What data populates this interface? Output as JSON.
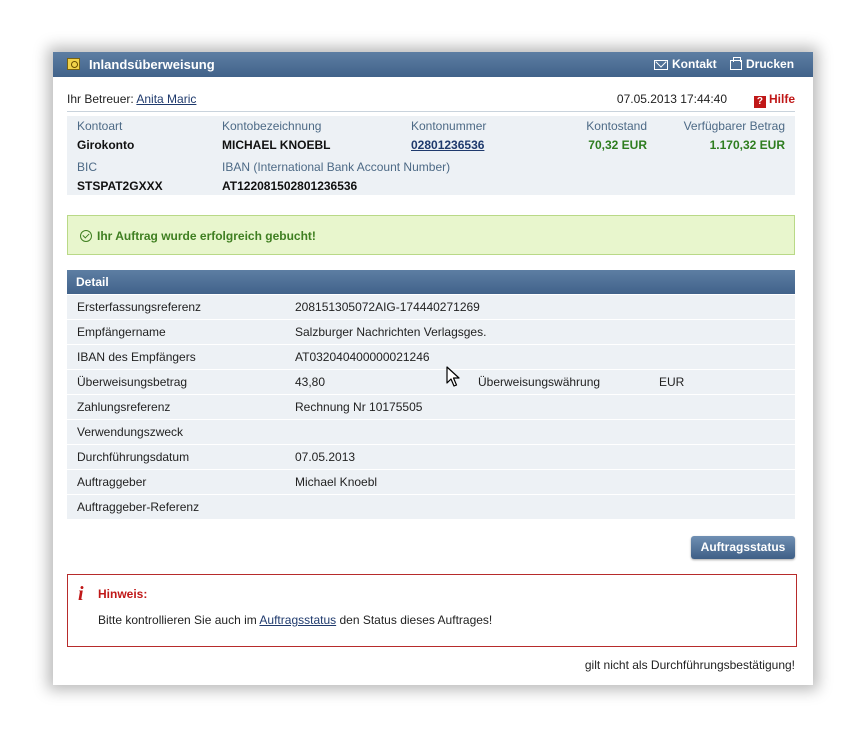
{
  "window": {
    "title": "Inlandsüberweisung",
    "links": {
      "kontakt": "Kontakt",
      "drucken": "Drucken"
    }
  },
  "header": {
    "betreuer_label": "Ihr Betreuer:",
    "betreuer_name": "Anita Maric",
    "datetime": "07.05.2013 17:44:40",
    "hilfe": "Hilfe"
  },
  "account": {
    "labels": {
      "kontoart": "Kontoart",
      "kontobezeichnung": "Kontobezeichnung",
      "kontonummer": "Kontonummer",
      "kontostand": "Kontostand",
      "verfuegbar": "Verfügbarer Betrag",
      "bic": "BIC",
      "iban": "IBAN (International Bank Account Number)"
    },
    "values": {
      "kontoart": "Girokonto",
      "kontobezeichnung": "MICHAEL KNOEBL",
      "kontonummer": "02801236536",
      "kontostand": "70,32 EUR",
      "verfuegbar": "1.170,32 EUR",
      "bic": "STSPAT2GXXX",
      "iban": "AT122081502801236536"
    }
  },
  "success_message": "Ihr Auftrag wurde erfolgreich gebucht!",
  "detail": {
    "title": "Detail",
    "rows": [
      {
        "label": "Ersterfassungsreferenz",
        "value": "208151305072AIG-174440271269"
      },
      {
        "label": "Empfängername",
        "value": "Salzburger Nachrichten Verlagsges."
      },
      {
        "label": "IBAN des Empfängers",
        "value": "AT032040400000021246"
      },
      {
        "label": "Überweisungsbetrag",
        "value": "43,80",
        "label2": "Überweisungswährung",
        "value2": "EUR"
      },
      {
        "label": "Zahlungsreferenz",
        "value": "Rechnung Nr 10175505"
      },
      {
        "label": "Verwendungszweck",
        "value": ""
      },
      {
        "label": "Durchführungsdatum",
        "value": "07.05.2013"
      },
      {
        "label": "Auftraggeber",
        "value": "Michael Knoebl"
      },
      {
        "label": "Auftraggeber-Referenz",
        "value": ""
      }
    ]
  },
  "buttons": {
    "auftragsstatus": "Auftragsstatus"
  },
  "hinweis": {
    "title": "Hinweis:",
    "text_before": "Bitte kontrollieren Sie auch im",
    "link": "Auftragsstatus",
    "text_after": "den Status dieses Auftrages!"
  },
  "footer_note": "gilt nicht als Durchführungsbestätigung!",
  "colors": {
    "header_blue": "#41628a",
    "success_green": "#3f7f21",
    "alert_red": "#c01818"
  }
}
